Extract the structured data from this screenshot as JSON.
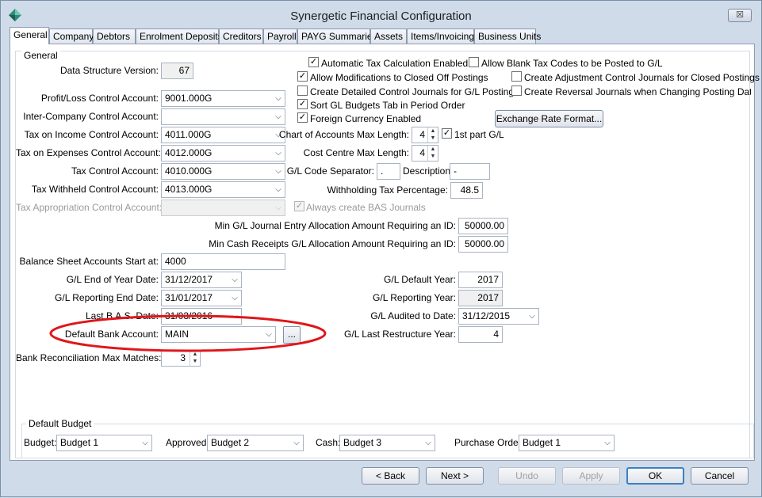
{
  "window": {
    "title": "Synergetic Financial Configuration",
    "close_label": "☒"
  },
  "tabs": [
    {
      "label": "General"
    },
    {
      "label": "Company"
    },
    {
      "label": "Debtors"
    },
    {
      "label": "Enrolment Deposits"
    },
    {
      "label": "Creditors"
    },
    {
      "label": "Payroll"
    },
    {
      "label": "PAYG Summaries"
    },
    {
      "label": "Assets"
    },
    {
      "label": "Items/Invoicing"
    },
    {
      "label": "Business Units"
    }
  ],
  "general": {
    "group_title": "General",
    "data_structure_version": {
      "label": "Data Structure Version:",
      "value": "67"
    },
    "profit_loss": {
      "label": "Profit/Loss Control Account:",
      "value": "9001.000G"
    },
    "inter_company": {
      "label": "Inter-Company Control Account:",
      "value": ""
    },
    "tax_income": {
      "label": "Tax on Income Control Account:",
      "value": "4011.000G"
    },
    "tax_expenses": {
      "label": "Tax on Expenses Control Account:",
      "value": "4012.000G"
    },
    "tax_control": {
      "label": "Tax Control Account:",
      "value": "4010.000G"
    },
    "tax_withheld": {
      "label": "Tax Withheld Control Account:",
      "value": "4013.000G"
    },
    "tax_appropriation": {
      "label": "Tax Appropriation Control Account:",
      "value": ""
    },
    "always_bas": {
      "label": "Always create BAS Journals",
      "checked": true
    },
    "auto_tax": {
      "label": "Automatic Tax Calculation Enabled",
      "checked": true
    },
    "allow_blank_tax": {
      "label": "Allow Blank Tax Codes to be Posted to G/L",
      "checked": false
    },
    "allow_mod_closed": {
      "label": "Allow Modifications to Closed Off Postings",
      "checked": true
    },
    "create_adjustment": {
      "label": "Create Adjustment Control Journals for Closed Postings",
      "checked": false
    },
    "create_detailed": {
      "label": "Create Detailed Control Journals for G/L Postings",
      "checked": false
    },
    "create_reversal": {
      "label": "Create Reversal Journals when Changing Posting Date if Clo",
      "checked": false
    },
    "sort_gl_budgets": {
      "label": "Sort GL Budgets Tab in Period Order",
      "checked": true
    },
    "foreign_currency": {
      "label": "Foreign Currency Enabled",
      "checked": true
    },
    "exchange_rate_button": "Exchange Rate Format...",
    "chart_max_length": {
      "label": "Chart of Accounts Max Length:",
      "value": "4"
    },
    "first_part_gl": {
      "label": "1st part G/L",
      "checked": true
    },
    "cost_centre_max": {
      "label": "Cost Centre Max Length:",
      "value": "4"
    },
    "gl_separator": {
      "label": "G/L Code Separator:",
      "value": "."
    },
    "description": {
      "label": "Description:",
      "value": "-"
    },
    "withholding_pct": {
      "label": "Withholding Tax Percentage:",
      "value": "48.5"
    },
    "min_journal": {
      "label": "Min G/L Journal Entry Allocation Amount Requiring an ID:",
      "value": "50000.00"
    },
    "min_cash": {
      "label": "Min Cash Receipts G/L Allocation Amount Requiring an ID:",
      "value": "50000.00"
    },
    "balance_sheet": {
      "label": "Balance Sheet Accounts Start at:",
      "value": "4000"
    },
    "gl_end_year": {
      "label": "G/L End of Year Date:",
      "value": "31/12/2017"
    },
    "gl_reporting_end": {
      "label": "G/L Reporting End Date:",
      "value": "31/01/2017"
    },
    "last_bas": {
      "label": "Last B.A.S. Date:",
      "value": "31/03/2016"
    },
    "default_bank": {
      "label": "Default Bank Account:",
      "value": "MAIN",
      "browse": "..."
    },
    "bank_rec_max": {
      "label": "Bank Reconciliation Max Matches:",
      "value": "3"
    },
    "gl_default_year": {
      "label": "G/L Default Year:",
      "value": "2017"
    },
    "gl_reporting_year": {
      "label": "G/L Reporting Year:",
      "value": "2017"
    },
    "gl_audited": {
      "label": "G/L Audited to Date:",
      "value": "31/12/2015"
    },
    "gl_restructure": {
      "label": "G/L Last Restructure Year:",
      "value": "4"
    }
  },
  "budget": {
    "group_title": "Default Budget",
    "budget": {
      "label": "Budget:",
      "value": "Budget 1"
    },
    "approved": {
      "label": "Approved:",
      "value": "Budget 2"
    },
    "cash": {
      "label": "Cash:",
      "value": "Budget 3"
    },
    "purchase_order": {
      "label": "Purchase Order:",
      "value": "Budget 1"
    }
  },
  "footer": {
    "back": "< Back",
    "next": "Next >",
    "undo": "Undo",
    "apply": "Apply",
    "ok": "OK",
    "cancel": "Cancel"
  },
  "colors": {
    "annotation": "#e0161b",
    "window_bg": "#cfdbe9",
    "default_button_border": "#3c7fc1"
  }
}
